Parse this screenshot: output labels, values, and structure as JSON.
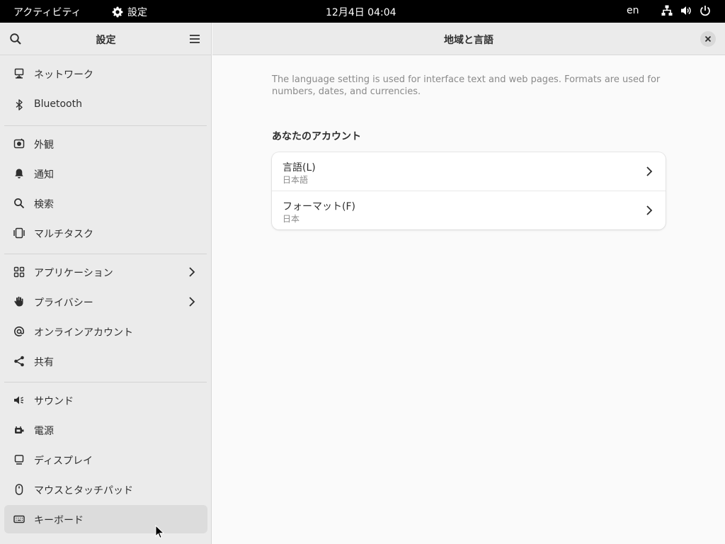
{
  "topbar": {
    "activities": "アクティビティ",
    "app_name": "設定",
    "clock": "12月4日  04:04",
    "input_lang": "en"
  },
  "sidebar": {
    "title": "設定",
    "items": [
      {
        "label": "ネットワーク",
        "icon": "network-icon"
      },
      {
        "label": "Bluetooth",
        "icon": "bluetooth-icon"
      },
      {
        "label": "外観",
        "icon": "appearance-icon"
      },
      {
        "label": "通知",
        "icon": "bell-icon"
      },
      {
        "label": "検索",
        "icon": "search-icon"
      },
      {
        "label": "マルチタスク",
        "icon": "multitasking-icon"
      },
      {
        "label": "アプリケーション",
        "icon": "apps-grid-icon"
      },
      {
        "label": "プライバシー",
        "icon": "hand-icon"
      },
      {
        "label": "オンラインアカウント",
        "icon": "at-sign-icon"
      },
      {
        "label": "共有",
        "icon": "share-icon"
      },
      {
        "label": "サウンド",
        "icon": "speaker-icon"
      },
      {
        "label": "電源",
        "icon": "power-plug-icon"
      },
      {
        "label": "ディスプレイ",
        "icon": "display-icon"
      },
      {
        "label": "マウスとタッチパッド",
        "icon": "mouse-icon"
      },
      {
        "label": "キーボード",
        "icon": "keyboard-icon"
      }
    ],
    "selected": "キーボード"
  },
  "main": {
    "title": "地域と言語",
    "description": "The language setting is used for interface text and web pages. Formats are used for numbers, dates, and currencies.",
    "section_title": "あなたのアカウント",
    "rows": [
      {
        "name": "言語(L)",
        "value": "日本語"
      },
      {
        "name": "フォーマット(F)",
        "value": "日本"
      }
    ]
  }
}
